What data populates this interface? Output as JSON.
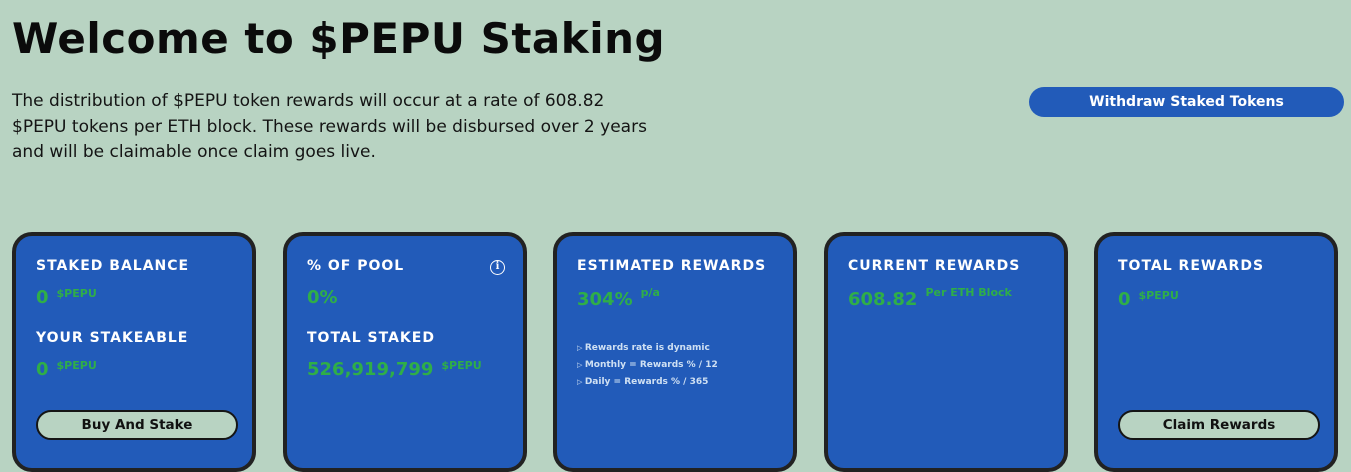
{
  "header": {
    "title": "Welcome to $PEPU Staking",
    "description": "The distribution of $PEPU token rewards will occur at a rate of 608.82 $PEPU tokens per ETH block. These rewards will be disbursed over 2 years and will be claimable once claim goes live.",
    "withdraw_label": "Withdraw Staked Tokens"
  },
  "cards": {
    "staked": {
      "label": "STAKED BALANCE",
      "value": "0",
      "unit": "$PEPU",
      "stakeable_label": "YOUR STAKEABLE",
      "stakeable_value": "0",
      "stakeable_unit": "$PEPU",
      "button_label": "Buy And Stake"
    },
    "pool": {
      "label": "% OF POOL",
      "value": "0%",
      "info_icon": "i",
      "total_label": "TOTAL STAKED",
      "total_value": "526,919,799",
      "total_unit": "$PEPU"
    },
    "estimated": {
      "label": "ESTIMATED REWARDS",
      "value": "304%",
      "unit": "p/a",
      "notes": [
        "Rewards rate is dynamic",
        "Monthly = Rewards % / 12",
        "Daily = Rewards % / 365"
      ]
    },
    "current": {
      "label": "CURRENT REWARDS",
      "value": "608.82",
      "unit": "Per ETH Block"
    },
    "total": {
      "label": "TOTAL REWARDS",
      "value": "0",
      "unit": "$PEPU",
      "button_label": "Claim Rewards"
    }
  },
  "colors": {
    "background": "#b8d3c2",
    "card": "#225bb9",
    "accent_green": "#2fae48",
    "border": "#222222"
  }
}
